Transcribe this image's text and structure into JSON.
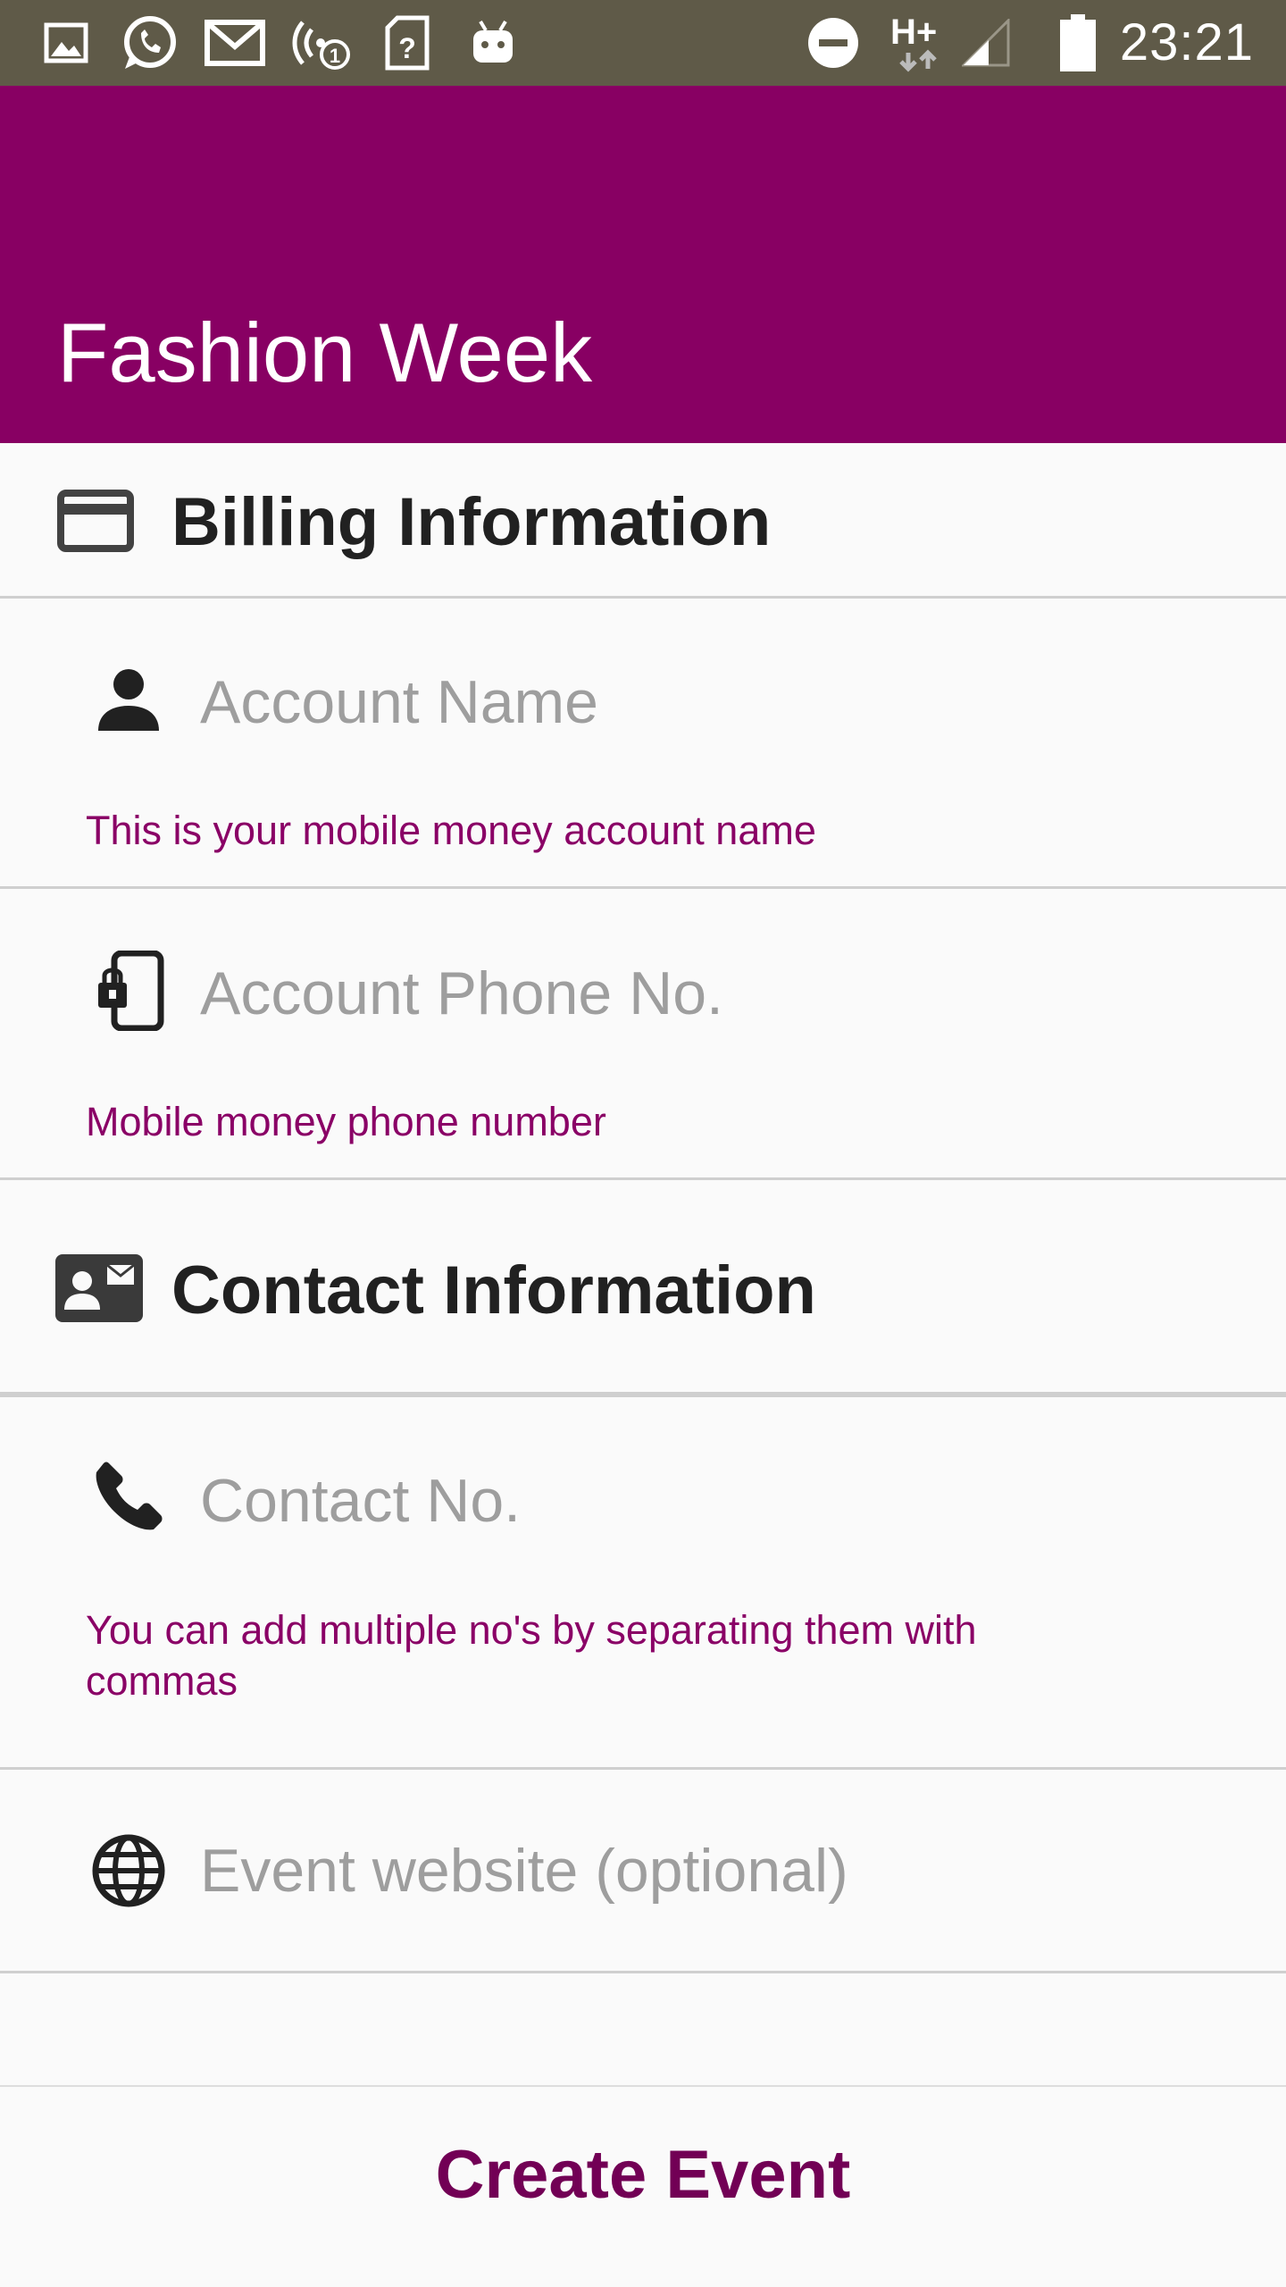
{
  "status_bar": {
    "time": "23:21",
    "network_type": "H+",
    "left_icons": [
      "gallery-icon",
      "whatsapp-icon",
      "gmail-icon",
      "wireless-alert-icon",
      "sim-unknown-icon",
      "android-icon"
    ],
    "right_icons": [
      "do-not-disturb-icon",
      "network-icon",
      "signal-icon",
      "battery-icon"
    ]
  },
  "app_bar": {
    "title": "Fashion Week",
    "color": "#880063"
  },
  "billing": {
    "title": "Billing Information",
    "icon": "credit-card-icon",
    "account_name": {
      "placeholder": "Account Name",
      "value": "",
      "icon": "person-icon",
      "helper": "This is your mobile money account name"
    },
    "account_phone": {
      "placeholder": "Account Phone No.",
      "value": "",
      "icon": "phone-lock-icon",
      "helper": "Mobile money phone number"
    }
  },
  "contact": {
    "title": "Contact Information",
    "icon": "contact-card-icon",
    "contact_no": {
      "placeholder": "Contact No.",
      "value": "",
      "icon": "phone-icon",
      "helper": "You can add multiple no's by separating them with commas"
    },
    "website": {
      "placeholder": "Event website (optional)",
      "value": "",
      "icon": "globe-icon"
    }
  },
  "actions": {
    "create_label": "Create Event"
  },
  "colors": {
    "accent": "#880063",
    "helper_text": "#8a0066",
    "status_bar": "#5f5a48"
  }
}
